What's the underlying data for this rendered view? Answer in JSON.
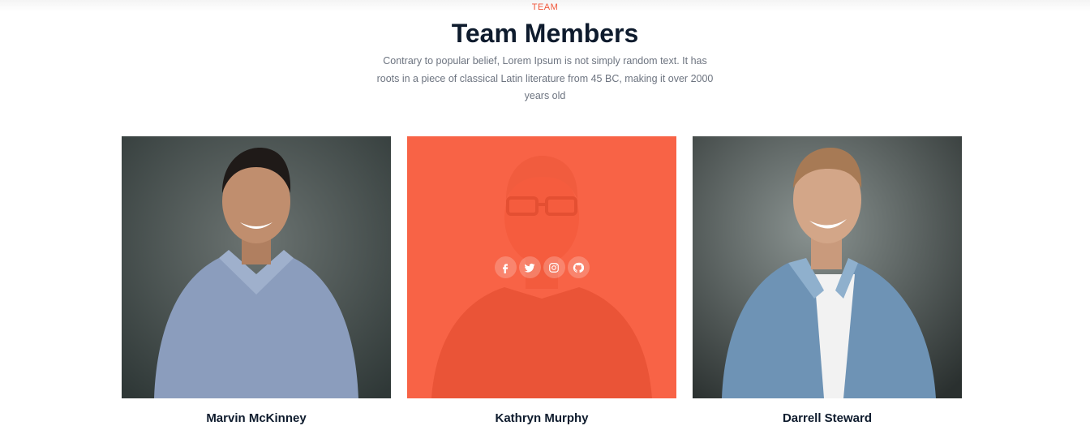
{
  "section": {
    "eyebrow": "TEAM",
    "title": "Team Members",
    "description": "Contrary to popular belief, Lorem Ipsum is not simply random text. It has roots in a piece of classical Latin literature from 45 BC, making it over 2000 years old"
  },
  "members": [
    {
      "name": "Marvin McKinney"
    },
    {
      "name": "Kathryn Murphy",
      "hovered": true
    },
    {
      "name": "Darrell Steward"
    }
  ],
  "social_icons": [
    "facebook-icon",
    "twitter-icon",
    "instagram-icon",
    "github-icon"
  ],
  "colors": {
    "accent": "#f0573a",
    "overlay": "#fa5434",
    "heading": "#0e1b2d",
    "body_text": "#6d7480"
  }
}
